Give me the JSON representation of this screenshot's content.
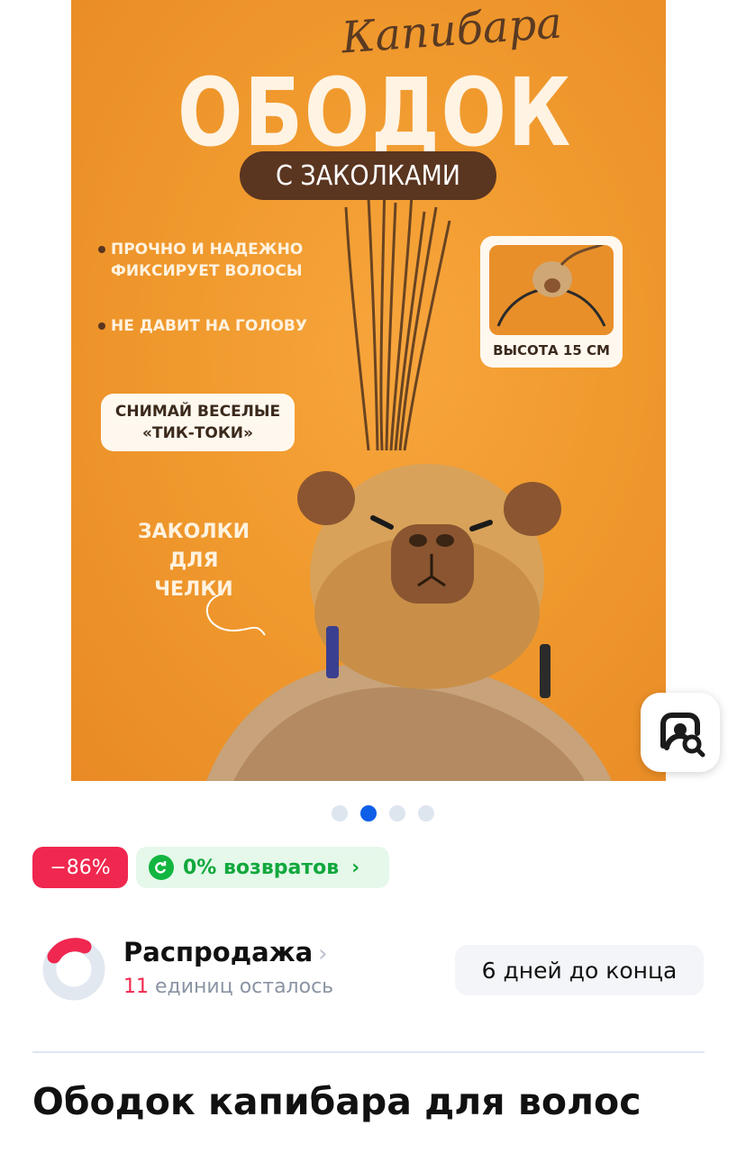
{
  "hero": {
    "script_title": "Капибара",
    "big_title": "ОБОДОК",
    "subtitle_pill": "С ЗАКОЛКАМИ",
    "bullet_1_line1": "ПРОЧНО И НАДЕЖНО",
    "bullet_1_line2": "ФИКСИРУЕТ ВОЛОСЫ",
    "bullet_2": "НЕ ДАВИТ НА ГОЛОВУ",
    "height_label": "ВЫСОТА 15 СМ",
    "tiktok_line1": "СНИМАЙ ВЕСЕЛЫЕ",
    "tiktok_line2": "«ТИК-ТОКИ»",
    "clips_line1": "ЗАКОЛКИ",
    "clips_line2": "ДЛЯ ЧЕЛКИ"
  },
  "carousel": {
    "count": 4,
    "active_index": 1
  },
  "badges": {
    "discount": "−86%",
    "returns": "0% возвратов"
  },
  "sale": {
    "title": "Распродажа",
    "units_number": "11",
    "units_text": "единиц осталось",
    "days_left": "6 дней до конца"
  },
  "product": {
    "title": "Ободок капибара для волос"
  },
  "colors": {
    "accent_blue": "#0f5ee8",
    "discount_red": "#f0274f",
    "returns_green": "#12a83d"
  },
  "icons": {
    "image_search": "image-search-icon",
    "returns": "returns-icon",
    "chevron": "chevron-right-icon"
  }
}
